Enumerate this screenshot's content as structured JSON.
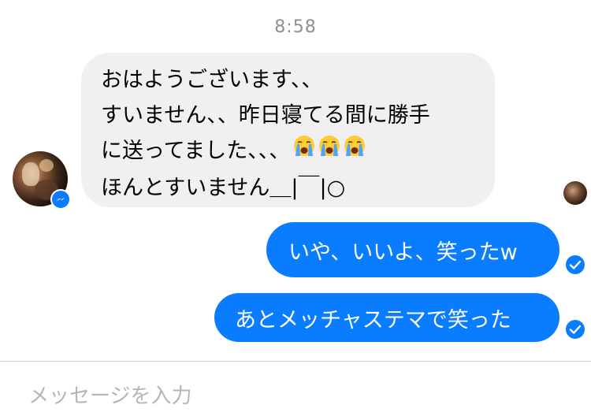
{
  "conversation": {
    "timestamp": "8:58",
    "incoming": {
      "lines": [
        "おはようございます、、",
        "すいません、、昨日寝てる間に勝手",
        "に送ってました、、、",
        "ほんとすいません＿|￣|○"
      ],
      "emoji": [
        "loudly-crying-face-icon",
        "loudly-crying-face-icon",
        "loudly-crying-face-icon"
      ]
    },
    "outgoing": [
      {
        "text": "いや、いいよ、笑ったw",
        "status": "sent"
      },
      {
        "text": "あとメッチャステマで笑った",
        "status": "sent"
      }
    ]
  },
  "composer": {
    "placeholder": "メッセージを入力",
    "value": ""
  },
  "colors": {
    "accent": "#0a7cff",
    "incoming_bubble": "#f0f0f0",
    "timestamp": "#8e8e93"
  }
}
